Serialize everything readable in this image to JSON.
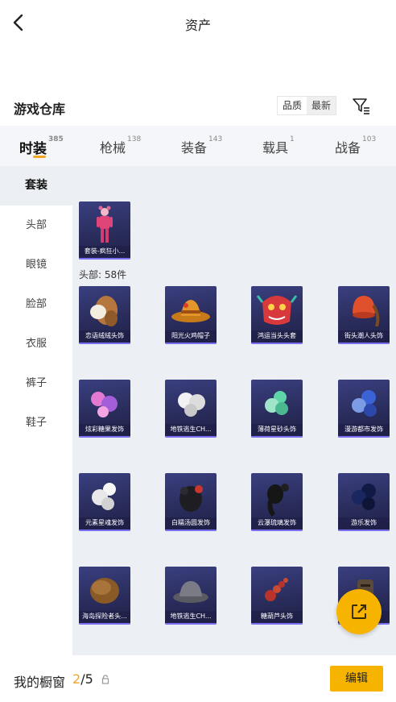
{
  "header": {
    "title": "资产"
  },
  "warehouse": {
    "title": "游戏仓库",
    "sort_options": [
      "品质",
      "最新"
    ]
  },
  "categories": [
    {
      "label": "时装",
      "count": "385"
    },
    {
      "label": "枪械",
      "count": "138"
    },
    {
      "label": "装备",
      "count": "143"
    },
    {
      "label": "载具",
      "count": "1"
    },
    {
      "label": "战备",
      "count": "103"
    }
  ],
  "sidebar": {
    "items": [
      "套装",
      "头部",
      "眼镜",
      "脸部",
      "衣服",
      "裤子",
      "鞋子"
    ]
  },
  "sections": {
    "suit_item": "套装-疯狂小...",
    "head_label": "头部: 58件"
  },
  "items": [
    "恋语绒绒头饰",
    "阳光火鸡帽子",
    "鸿运当头头套",
    "街头潮人头饰",
    "炫彩糖果发饰",
    "地铁逃生CH...",
    "薄荷星砂头饰",
    "漫游都市发饰",
    "元素星魂发饰",
    "白糯汤圆发饰",
    "云瀑琉璃发饰",
    "游乐发饰",
    "海岛探险者头...",
    "地铁逃生CH...",
    "糖葫芦头饰",
    ""
  ],
  "bottom": {
    "wardrobe_label": "我的橱窗",
    "wardrobe_current": "2",
    "wardrobe_total": "/5",
    "edit_label": "编辑"
  },
  "colors": {
    "accent": "#f6b400",
    "card_bg": "#2a2d5c"
  },
  "icons": [
    "back-icon",
    "filter-icon",
    "share-icon",
    "lock-icon"
  ]
}
